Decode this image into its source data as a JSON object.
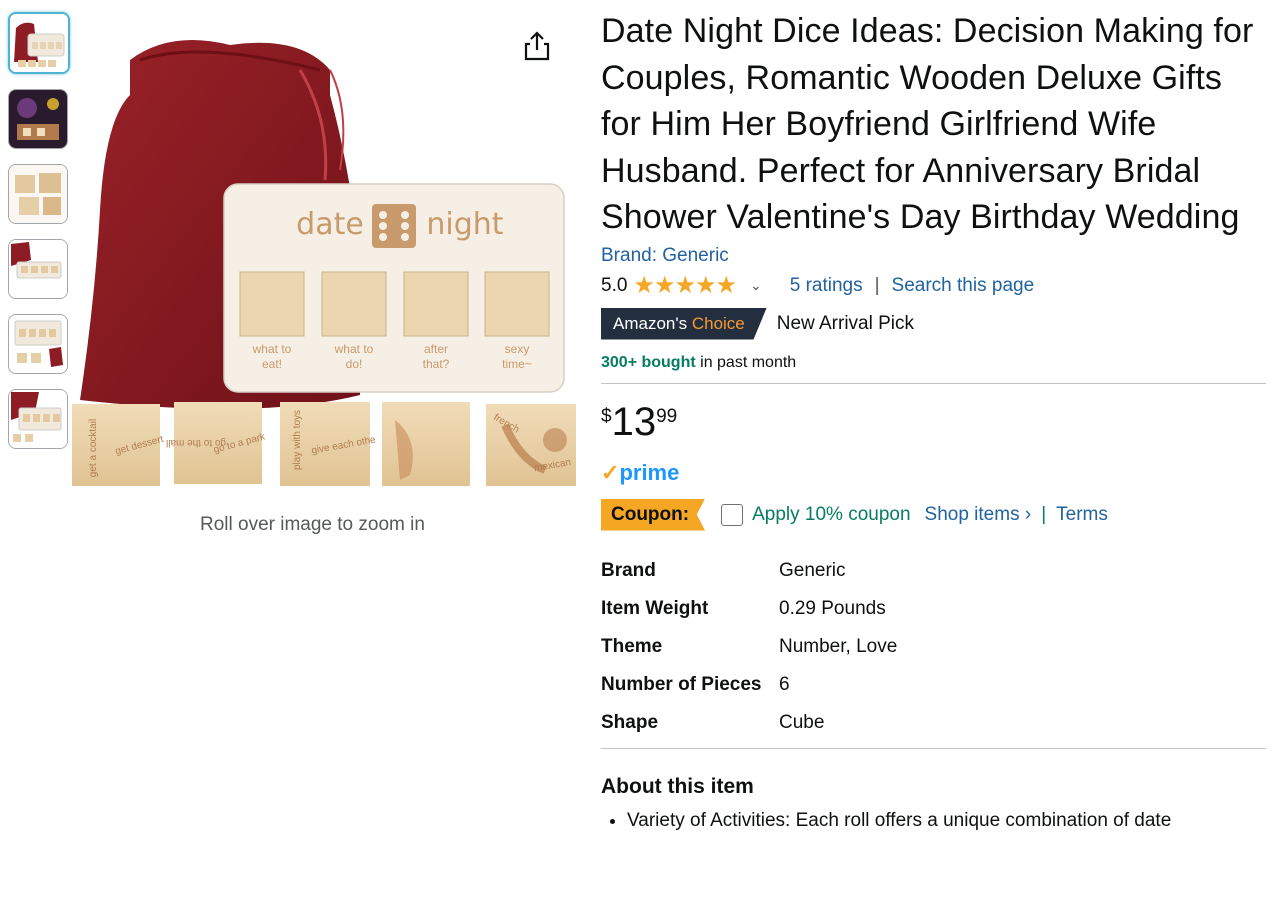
{
  "gallery": {
    "thumbnails": [
      {
        "label": "thumbnail-1"
      },
      {
        "label": "thumbnail-2"
      },
      {
        "label": "thumbnail-3"
      },
      {
        "label": "thumbnail-4"
      },
      {
        "label": "thumbnail-5"
      },
      {
        "label": "thumbnail-6"
      }
    ],
    "board": {
      "word1": "date",
      "word2": "night",
      "slots": [
        "what to\neat!",
        "what to\ndo!",
        "after\nthat?",
        "sexy\ntime~"
      ]
    },
    "dice": [
      "get a cocktail",
      "get dessert",
      "go to the mall",
      "go to a park",
      "play with toys",
      "give each other a massage",
      "french",
      "mexican"
    ],
    "zoom_hint": "Roll over image to zoom in",
    "share_icon": "share-icon"
  },
  "product": {
    "title": "Date Night Dice Ideas: Decision Making for Couples, Romantic Wooden Deluxe Gifts for Him Her Boyfriend Girlfriend Wife Husband. Perfect for Anniversary Bridal Shower Valentine's Day Birthday Wedding",
    "brand_link": "Brand: Generic",
    "rating": "5.0",
    "stars": 5,
    "ratings_link": "5 ratings",
    "rating_sep": "|",
    "search_link": "Search this page",
    "badge": {
      "part1": "Amazon's",
      "part2": "Choice"
    },
    "badge_text": "New Arrival Pick",
    "bought_bold": "300+ bought",
    "bought_rest": " in past month",
    "price": {
      "symbol": "$",
      "whole": "13",
      "fraction": "99"
    },
    "prime": {
      "check": "✓",
      "label": "prime"
    },
    "coupon": {
      "badge": "Coupon:",
      "text": "Apply 10% coupon",
      "shop": "Shop items ›",
      "sep": "|",
      "terms": "Terms"
    },
    "specs": [
      {
        "key": "Brand",
        "value": "Generic"
      },
      {
        "key": "Item Weight",
        "value": "0.29 Pounds"
      },
      {
        "key": "Theme",
        "value": "Number, Love"
      },
      {
        "key": "Number of Pieces",
        "value": "6"
      },
      {
        "key": "Shape",
        "value": "Cube"
      }
    ],
    "about_title": "About this item",
    "bullets": [
      "Variety of Activities: Each roll offers a unique combination of date"
    ]
  },
  "colors": {
    "link": "#2162a1",
    "star": "#f5a623",
    "green": "#067d62",
    "badge_bg": "#232f3e",
    "badge_orange": "#f69931",
    "prime_blue": "#1a98ff",
    "bag": "#8e1c24"
  }
}
